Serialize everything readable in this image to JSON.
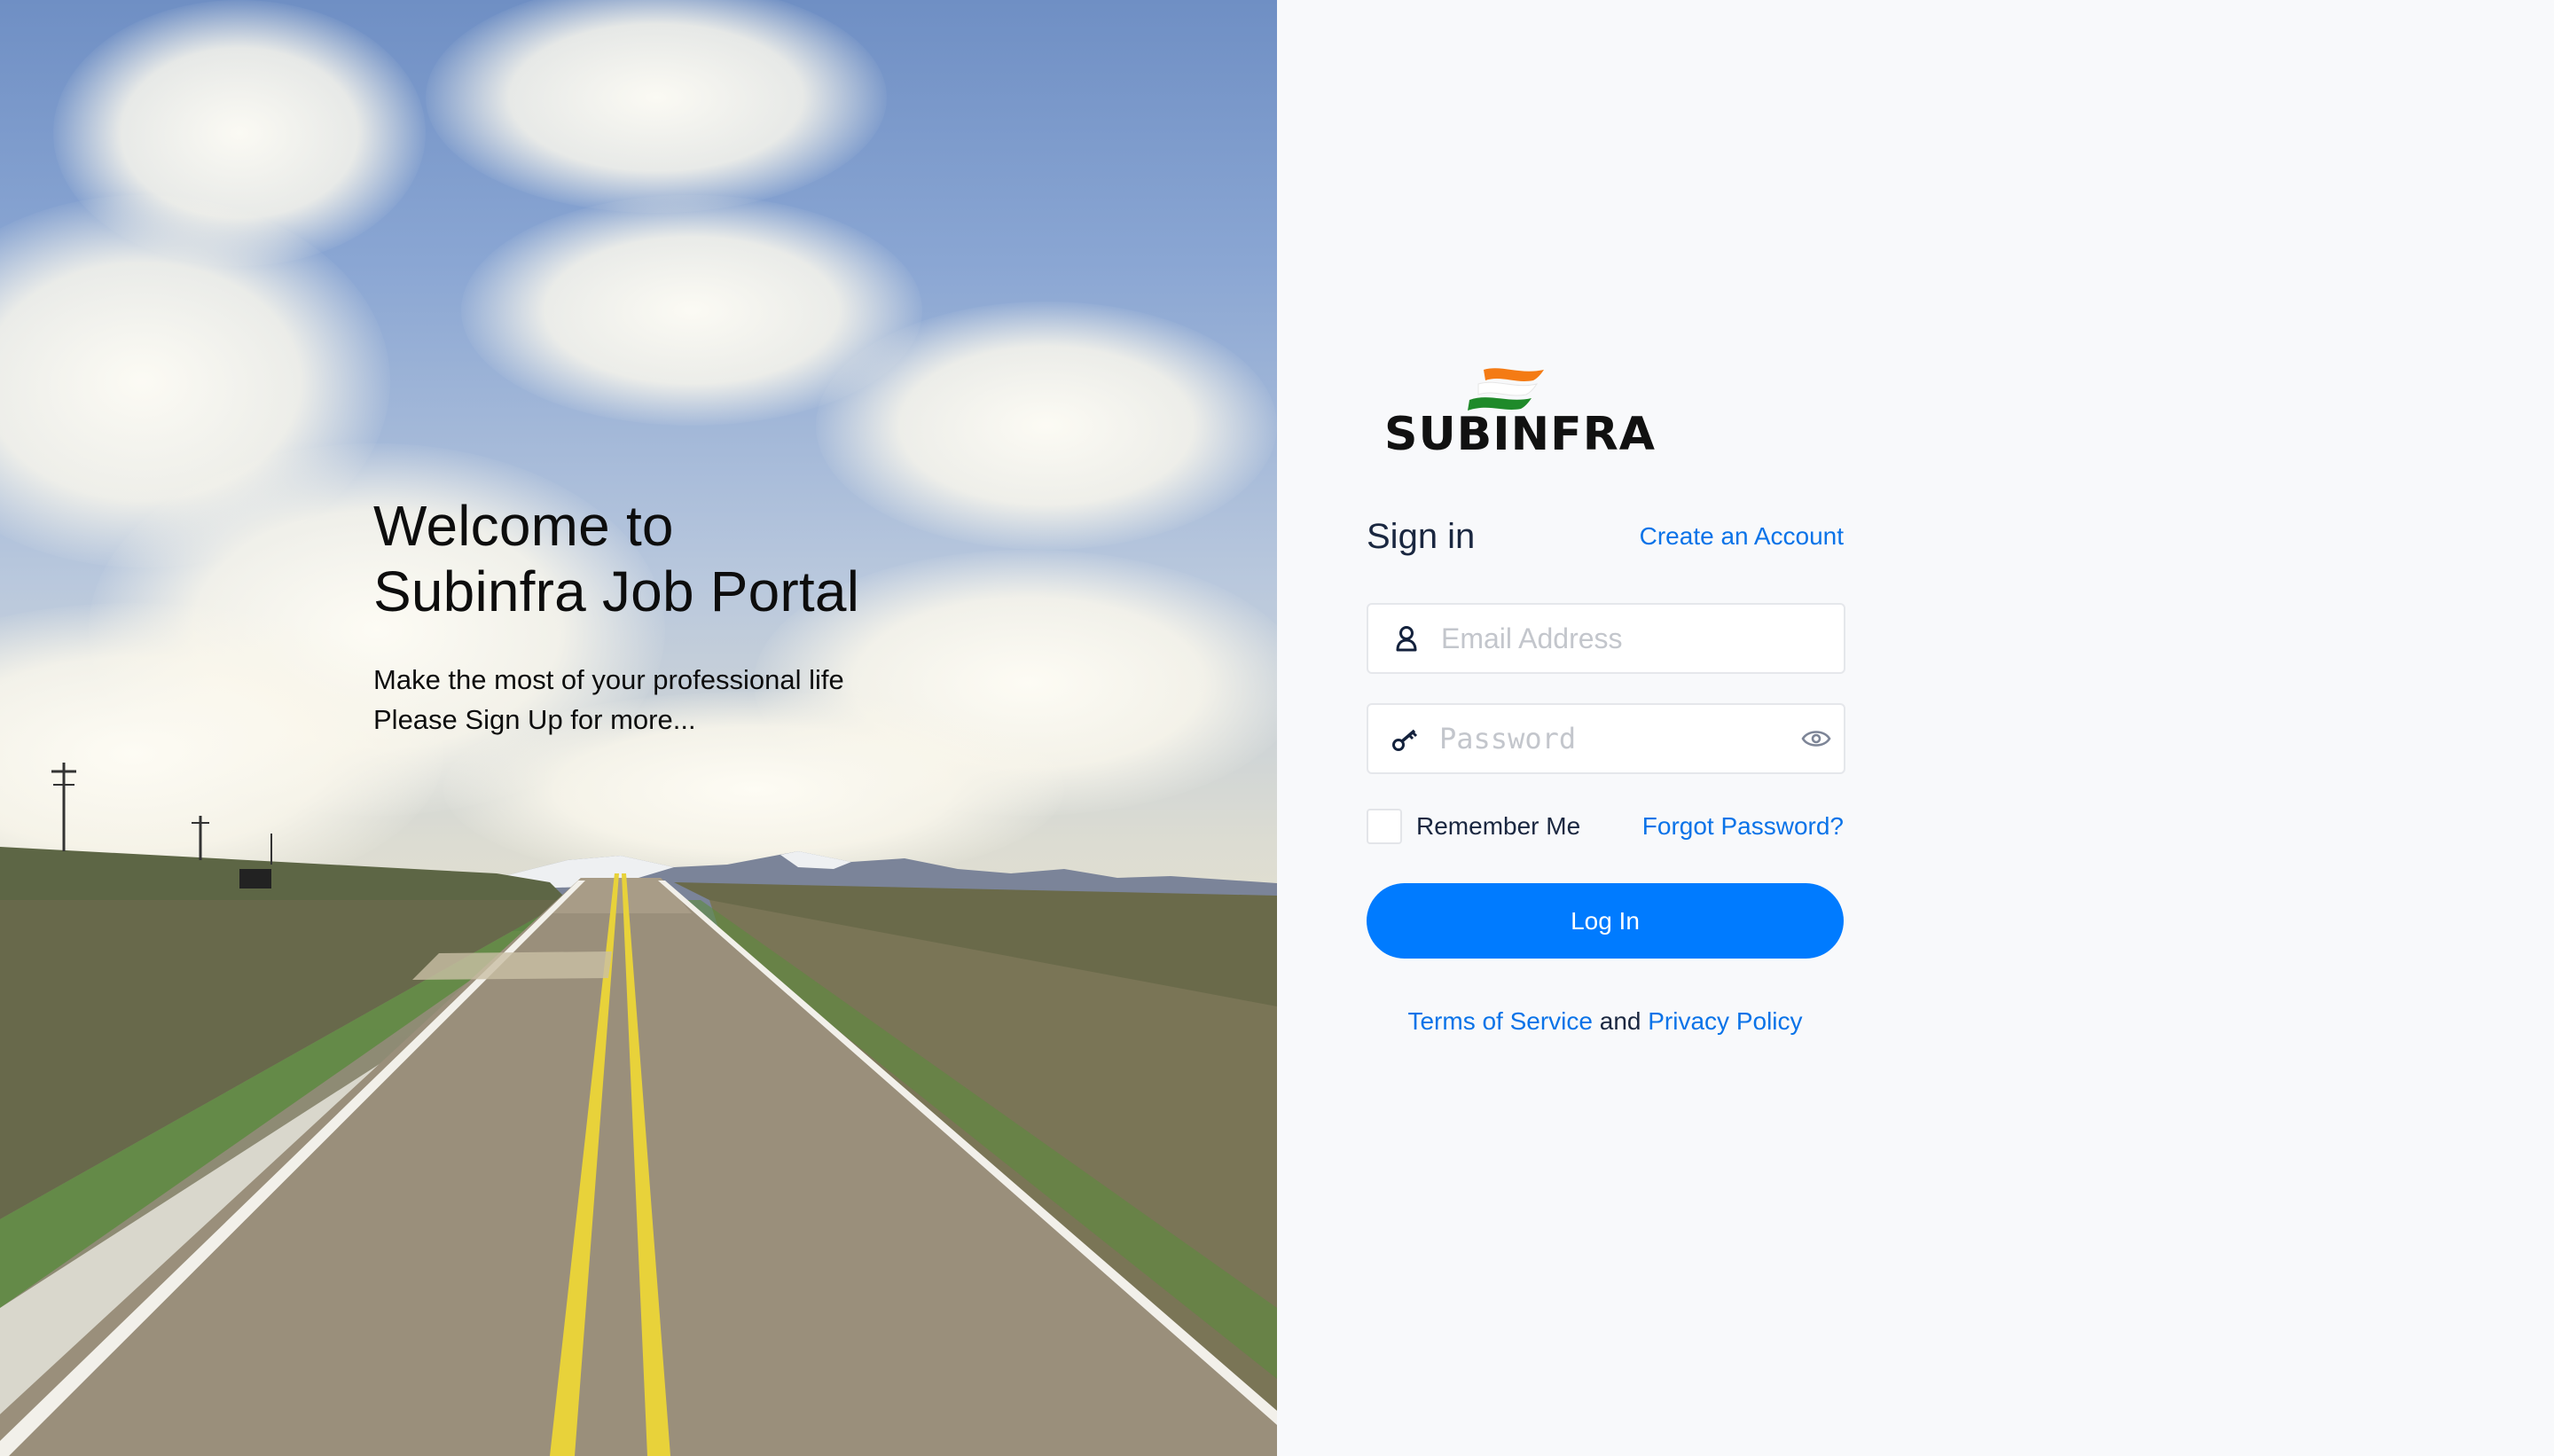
{
  "hero": {
    "title_line1": "Welcome to",
    "title_line2": "Subinfra Job Portal",
    "subtitle_line1": "Make the most of your professional life",
    "subtitle_line2": "Please Sign Up for more..."
  },
  "brand": {
    "logo_text": "SUBINFRA",
    "logo_icon": "flag-icon",
    "flag_colors": [
      "#f47b14",
      "#ffffff",
      "#1f8a2a"
    ]
  },
  "form": {
    "title": "Sign in",
    "create_account_label": "Create an Account",
    "email": {
      "placeholder": "Email Address",
      "value": "",
      "icon": "user-icon"
    },
    "password": {
      "placeholder": "Password",
      "value": "",
      "icon": "key-icon",
      "toggle_icon": "eye-icon"
    },
    "remember_me_label": "Remember Me",
    "remember_me_checked": false,
    "forgot_password_label": "Forgot Password?",
    "login_label": "Log In"
  },
  "legal": {
    "terms_label": "Terms of Service",
    "connector": "and",
    "privacy_label": "Privacy Policy"
  },
  "colors": {
    "accent": "#007bff",
    "link": "#0a73e8",
    "text_dark": "#1a2740",
    "panel_bg": "#f8f9fb"
  }
}
